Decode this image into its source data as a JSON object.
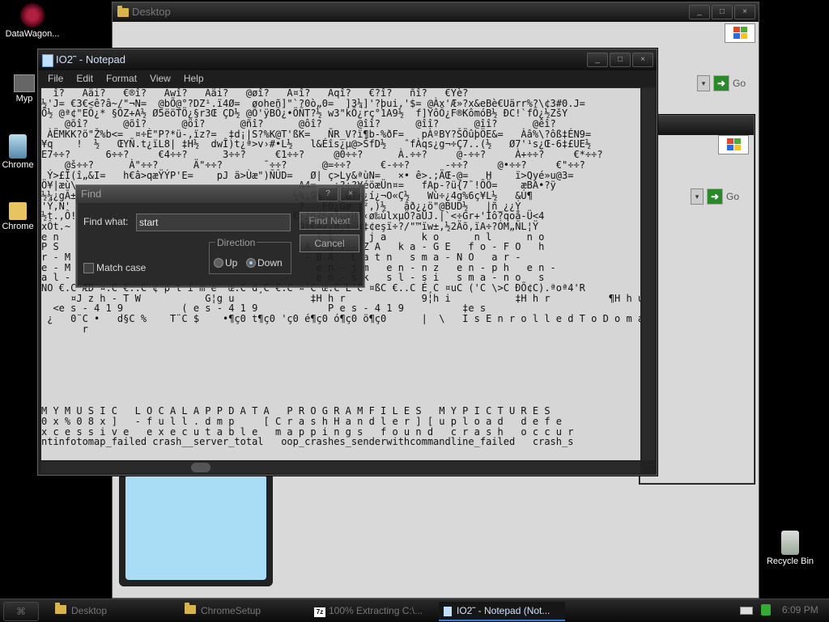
{
  "desktop": {
    "icons": [
      {
        "label": "DataWagon..."
      },
      {
        "label": "Myp"
      },
      {
        "label": "Chrome"
      },
      {
        "label": "Chrome"
      },
      {
        "label": "Recycle Bin"
      }
    ]
  },
  "explorer1": {
    "title": "Desktop",
    "go_label": "Go"
  },
  "explorer2": {
    "go_label": "Go"
  },
  "notepad": {
    "title": "IO2˜ - Notepad",
    "menu": [
      "File",
      "Edit",
      "Format",
      "View",
      "Help"
    ],
    "lines": [
      "  î?   Àäi?   €®î?   Àwî?   Àäi?   @øî?   À¤î?   Àqî?   €?î?   ñî?   €Ÿè?",
      "½'J= €3€<ê?â~/\"¬N=  @bÕ@°?DZ¹.ï4Ø=  øoheñ]\"`?0ò„0=  ]3¼]'?þui,'$= @Àx'Æ»?x&eBè€Uärr%?\\¢3#0.J=",
      "Ö½ @ª¢\"EÕ¿* §ÕZ+A½ Ø5ëöTÖ¿§r3Œ ÇD½ @Õ'ÿBÕ¿•ÖÑT?½ w3\"kÕ¿rç°1A9½  f]YôÕ¿F®KômóB½ ÐC!`fÕ¿½ZšY",
      "    @õî?      @õî?      @öî?      @ñî?      @ôî?      @îî?      @îî?      @îî?      @êî?",
      " ÀËMKK?ö\"Ž%b<=  ¤÷È\"P?*ü-,ïz?=  ‡d¡|S?%K@T'ßK=   ÑR_V?ï¶b-%ðF=   pÀºBY?ŠÖûþÖE&=   Àâ%\\?ôß‡ÉN9=",
      "¥q    !  ½   ŒYÑ.t¿ïL8| ‡H½  dwÎ)t¿ª>v›#•L½   l&Éîs¿µ@>ŠfD½   ˆfÀqs¿g¬÷Ç7..(½   Ø7'¹s¿Œ-6‡£UE½",
      "E7÷÷?      6÷÷?     €4÷÷?      3÷÷?     €1÷÷?     @0÷÷?      À.÷÷?     @-÷÷?     À+÷÷?     €*÷÷?",
      "    @š÷÷?      À\"÷÷?      Ä\"÷÷?       ¯÷÷?      @=÷÷?     €-÷÷?      -÷÷?     @•÷÷?     €\"÷÷?",
      " Ý>£Î(î„&I=   h€â>qæŸÝP'E=    pJ ä>Ùæ\")ÑÛD=   Ø| ç>Ly&ªùN=   ×• ê>.;ÄŒ-@=   H    ï>Qyé»u@3=",
      "Ö¥|æù\\                                      A4=   ¡?÷?¥éöæÜn¤=   fAp-?ü{7¯!ÕÖ=    æBA•?ÿ",
      "½¼¿gÃ±                                     ½%;9½   ¸ù?÷¿í¿¬O«Ç½   Wù÷¿4g%6ç¥L½   &Ú¶",
      "'Ÿ,Ñ'                                       ?   FÕ¿Gø_j²,)½   âð¿¿ö\"@BUD½   |ñ_¿¿Ý",
      "½t.,Ô!                                     €>žô?5a1µxH'‹ø‰ùlxµÖ?aÜJ.|`<÷Gr+'Ìô?qoå-Ü<4",
      "xÔt.~                                       Ôï€÷?,π,f˜<‡¢eşï÷?/\"™ïw±,½2Äõ,ïA÷?ÓM„ÑL¦Ÿ",
      "e n                                            i t      j a      k o      n l      n o",
      "P S                                          A   a f - Z A   k a - G E   f o - F O   h",
      "r - M                                        - B A - L a t n   s m a - N O   a r -",
      "e - M                                          e n - j m   e n - n z   e n - p h   e n -",
      "a l -                                          e n - s k   s l - s i   s m a - n o   s",
      "NO €.C ÆD ¤.C €..C ¢ p t i m e  œ.C d¸C €.C ¤'C œ.C L'C ¤ßC €..C É¸C ¤uC ('C \\>C ÐÕ¢C).ªoª4'R",
      "     ¤J z h - T W           G¦g u             ‡H h r             9¦h i           ‡H h r          ¶H h u          µC s",
      "  <e s - 4 1 9          ( e s - 4 1 9            P e s - 4 1 9          ‡e s",
      " ¿   0¨C •   d§C %    T¨C $    •¶ç0 t¶ç0 'ç0 é¶ç0 ó¶ç0 ö¶ç0      |  \\   I s E n r o l l e d T o D o m a",
      "       r",
      "",
      "",
      "",
      "",
      "",
      "",
      "",
      "M Y M U S I C   L O C A L A P P D A T A   P R O G R A M F I L E S   M Y P I C T U R E S",
      "0 x % 0 8 x ]   - f u l l . d m p     [ C r a s h H a n d l e r ] [ u p l o a d   d e f e",
      "x c e s s i v e   e x e c u t a b l e   m a p p i n g s   f o u n d   c r a s h   o c c u r",
      "ntinfotomap_failed crash__server_total   oop_crashes_senderwithcommandline_failed   crash_s"
    ]
  },
  "find": {
    "title": "Find",
    "find_what_label": "Find what:",
    "find_value": "start",
    "find_next_label": "Find Next",
    "cancel_label": "Cancel",
    "direction_label": "Direction",
    "up_label": "Up",
    "down_label": "Down",
    "match_case_label": "Match case"
  },
  "taskbar": {
    "items": [
      {
        "label": "Desktop"
      },
      {
        "label": "ChromeSetup"
      },
      {
        "label": "100% Extracting C:\\..."
      },
      {
        "label": "IO2˜ - Notepad (Not..."
      }
    ],
    "clock": "6:09 PM"
  }
}
